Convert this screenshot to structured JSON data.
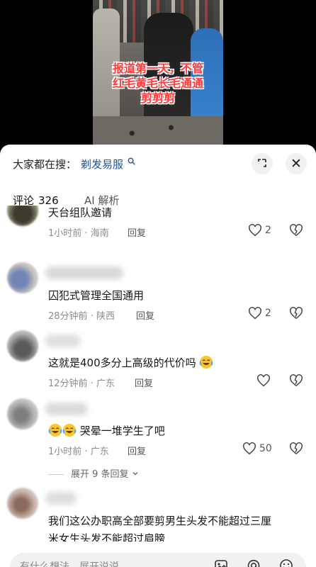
{
  "video": {
    "caption_lines": [
      "报道第一天，不管",
      "红毛黄毛长毛通通",
      "剪剪剪"
    ]
  },
  "search": {
    "lead": "大家都在搜：",
    "term": "剃发易服",
    "term_icon": "search-icon"
  },
  "buttons": {
    "expand_icon": "expand-icon",
    "close_icon": "close-icon",
    "close_glyph": "✕"
  },
  "tabs": {
    "comments_label": "评论",
    "comments_count": "326",
    "ai_label": "AI 解析"
  },
  "comments": [
    {
      "text": "天台组队邀请",
      "time": "1小时前",
      "location": "海南",
      "reply": "回复",
      "likes": "2"
    },
    {
      "text": "囚犯式管理全国通用",
      "time": "28分钟前",
      "location": "陕西",
      "reply": "回复",
      "likes": "2"
    },
    {
      "text": "这就是400多分上高级的代价吗",
      "time": "12分钟前",
      "location": "广东",
      "reply": "回复",
      "likes": "",
      "emoji_after": "crying-laughing-emoji"
    },
    {
      "text": "哭晕一堆学生了吧",
      "time": "1小时前",
      "location": "广东",
      "reply": "回复",
      "likes": "50",
      "emoji_before": [
        "crying-laughing-emoji",
        "crying-laughing-emoji"
      ]
    },
    {
      "text_line1": "我们这公办职高全部要剪男生头发不能超过三厘",
      "text_line2": "米女生头发不能超过肩膀"
    }
  ],
  "expand_replies": "展开 9 条回复",
  "input": {
    "placeholder": "有什么想法，展开说说",
    "icons": [
      "image-icon",
      "mention-icon",
      "emoji-icon"
    ]
  },
  "colors": {
    "caption": "#ff3b3b",
    "search_term": "#24548f"
  }
}
